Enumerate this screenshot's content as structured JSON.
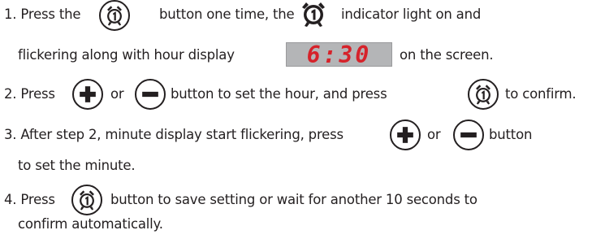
{
  "step1": {
    "text_a": "1. Press the",
    "text_b": "button one time, the",
    "text_c": "indicator light on and",
    "text_d": "flickering along with hour display",
    "text_e": "on the screen.",
    "lcd_time": "6:30"
  },
  "step2": {
    "text_a": "2. Press",
    "text_b": "or",
    "text_c": "button to set the hour, and press",
    "text_d": "to confirm."
  },
  "step3": {
    "text_a": "3. After step 2, minute display start flickering, press",
    "text_b": "or",
    "text_c": "button",
    "text_d": "to set the minute."
  },
  "step4": {
    "text_a": "4. Press",
    "text_b": "button to save setting or wait for another 10 seconds to",
    "text_c": "confirm automatically."
  },
  "icons": {
    "alarm_button": "alarm-clock-1-icon",
    "alarm_indicator": "alarm-indicator-1-icon",
    "plus_button": "plus-icon",
    "minus_button": "minus-icon"
  },
  "colors": {
    "text": "#231f20",
    "lcd_background": "#b4b5b7",
    "lcd_digits": "#d6222a"
  }
}
